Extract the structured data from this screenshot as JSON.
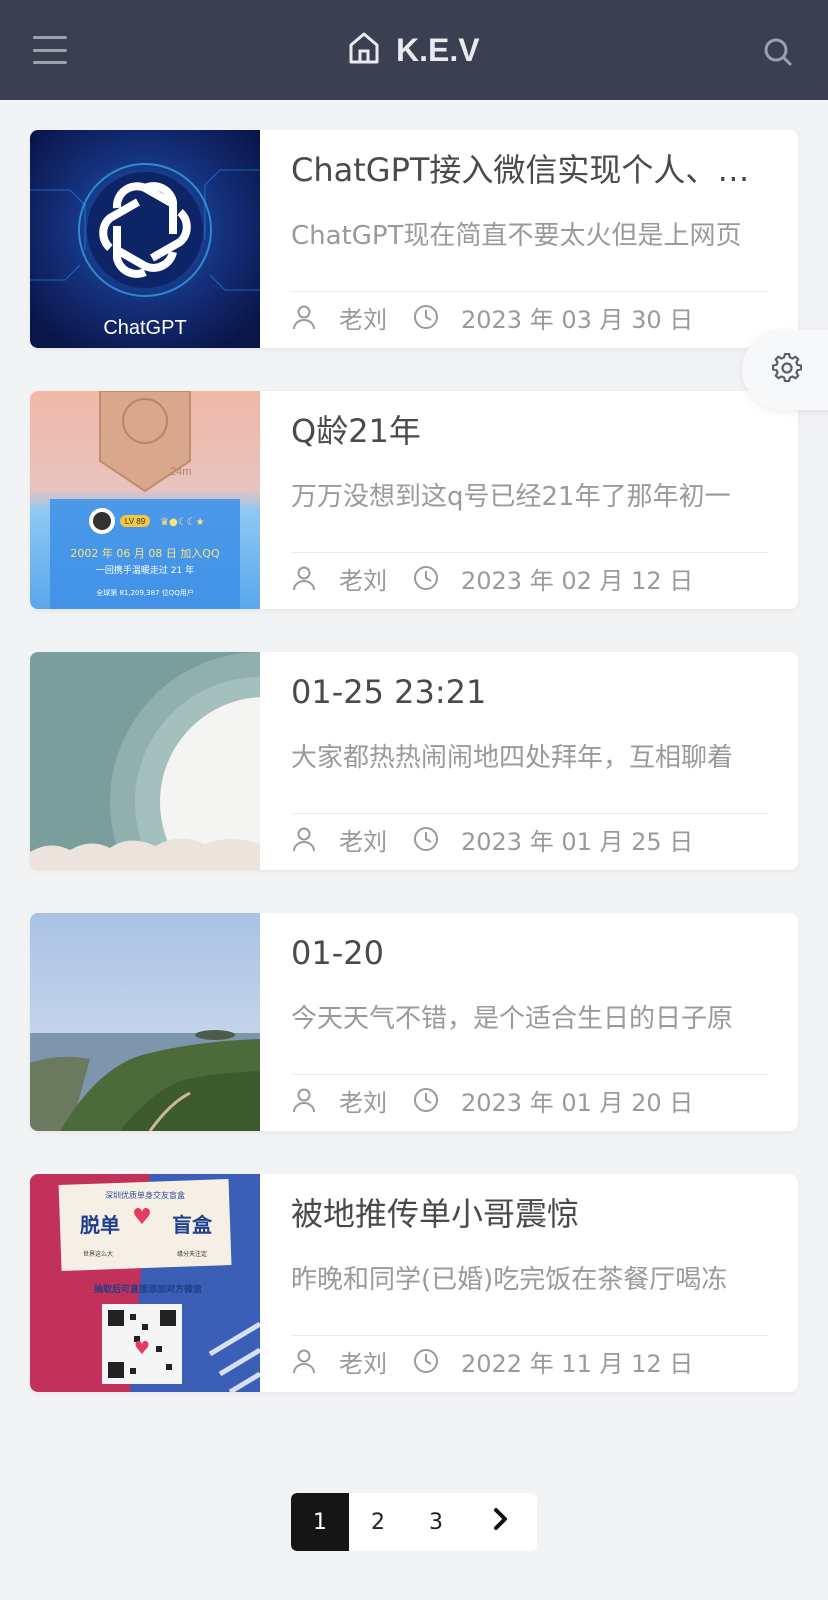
{
  "header": {
    "brand": "K.E.V",
    "menu_icon": "hamburger-menu-icon",
    "home_icon": "home-icon",
    "search_icon": "search-icon"
  },
  "posts": [
    {
      "title": "ChatGPT接入微信实现个人、…",
      "excerpt": "ChatGPT现在简直不要太火但是上网页",
      "author": "老刘",
      "date": "2023 年 03 月 30 日 …",
      "thumb_label": "ChatGPT"
    },
    {
      "title": "Q龄21年",
      "excerpt": "万万没想到这q号已经21年了那年初一",
      "author": "老刘",
      "date": "2023 年 02 月 12 日 …",
      "thumb_line1": "2002 年 06 月 08 日 加入QQ",
      "thumb_line2": "一回携手温暖走过 21 年",
      "thumb_line3": "全球第 81,209,387 位QQ用户",
      "thumb_badge": "24m",
      "thumb_level": "LV 89"
    },
    {
      "title": "01-25 23:21",
      "excerpt": "大家都热热闹闹地四处拜年，互相聊着",
      "author": "老刘",
      "date": "2023 年 01 月 25 日 …"
    },
    {
      "title": "01-20",
      "excerpt": "今天天气不错，是个适合生日的日子原",
      "author": "老刘",
      "date": "2023 年 01 月 20 日 …"
    },
    {
      "title": "被地推传单小哥震惊",
      "excerpt": "昨晚和同学(已婚)吃完饭在茶餐厅喝冻",
      "author": "老刘",
      "date": "2022 年 11 月 12 日 …",
      "thumb_top": "深圳优质单身交友盲盒",
      "thumb_left": "脱单",
      "thumb_right": "盲盒",
      "thumb_note1": "世界这么大",
      "thumb_note2": "缘分天注定",
      "thumb_bottom": "抽取后可直接添加对方微信"
    }
  ],
  "pagination": {
    "pages": [
      "1",
      "2",
      "3"
    ],
    "current": "1",
    "next_icon": "chevron-right-icon"
  },
  "settings_icon": "gear-icon",
  "colors": {
    "header_bg": "#3b3f52",
    "page_bg": "#f2f3f5",
    "active_page": "#151515"
  }
}
